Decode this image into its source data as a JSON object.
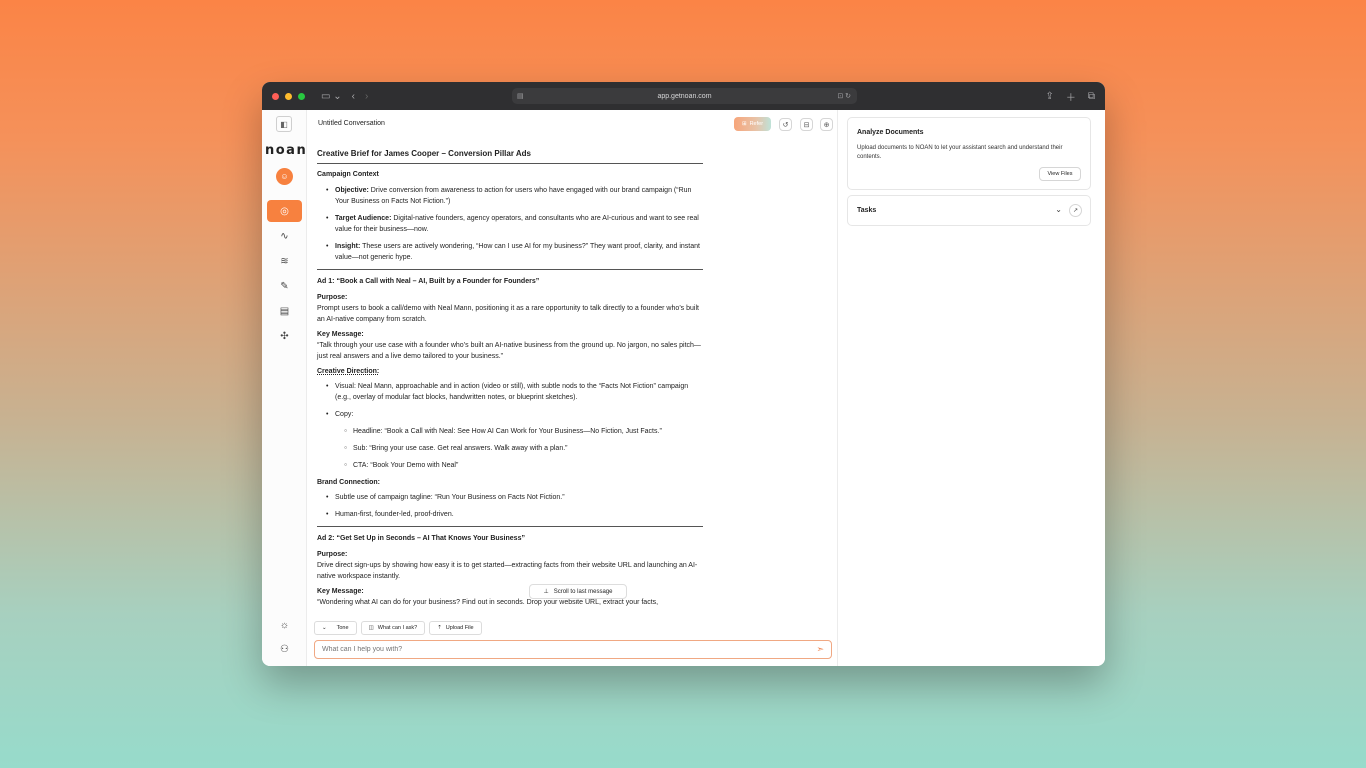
{
  "browser": {
    "url": "app.getnoan.com"
  },
  "sidebar": {
    "logo": "noan",
    "items": [
      {
        "name": "home",
        "active": true
      },
      {
        "name": "activity"
      },
      {
        "name": "layers"
      },
      {
        "name": "edit"
      },
      {
        "name": "notebook"
      },
      {
        "name": "network"
      }
    ]
  },
  "header": {
    "title": "Untitled Conversation",
    "refer_label": "Refer"
  },
  "brief": {
    "title": "Creative Brief for James Cooper – Conversion Pillar Ads",
    "campaign_context": "Campaign Context",
    "objective_label": "Objective:",
    "objective_text": " Drive conversion from awareness to action for users who have engaged with our brand campaign (“Run Your Business on Facts Not Fiction.”)",
    "audience_label": "Target Audience:",
    "audience_text": " Digital-native founders, agency operators, and consultants who are AI-curious and want to see real value for their business—now.",
    "insight_label": "Insight:",
    "insight_text": " These users are actively wondering, “How can I use AI for my business?” They want proof, clarity, and instant value—not generic hype.",
    "ad1_title": "Ad 1: “Book a Call with Neal – AI, Built by a Founder for Founders”",
    "purpose_label": "Purpose:",
    "ad1_purpose": "Prompt users to book a call/demo with Neal Mann, positioning it as a rare opportunity to talk directly to a founder who’s built an AI-native company from scratch.",
    "key_message_label": "Key Message:",
    "ad1_message": "“Talk through your use case with a founder who’s built an AI-native business from the ground up. No jargon, no sales pitch—just real answers and a live demo tailored to your business.”",
    "creative_direction_label": "Creative Direction:",
    "visual": "Visual: Neal Mann, approachable and in action (video or still), with subtle nods to the “Facts Not Fiction” campaign (e.g., overlay of modular fact blocks, handwritten notes, or blueprint sketches).",
    "copy_label": "Copy:",
    "headline": "Headline: “Book a Call with Neal: See How AI Can Work for Your Business—No Fiction, Just Facts.”",
    "sub": "Sub: “Bring your use case. Get real answers. Walk away with a plan.”",
    "cta": "CTA: “Book Your Demo with Neal”",
    "brand_connection_label": "Brand Connection:",
    "brand_1": "Subtle use of campaign tagline: “Run Your Business on Facts Not Fiction.”",
    "brand_2": "Human-first, founder-led, proof-driven.",
    "ad2_title": "Ad 2: “Get Set Up in Seconds – AI That Knows Your Business”",
    "ad2_purpose": "Drive direct sign-ups by showing how easy it is to get started—extracting facts from their website URL and launching an AI-native workspace instantly.",
    "ad2_message": "“Wondering what AI can do for your business? Find out in seconds. Drop your website URL, extract your facts,"
  },
  "scroll_pill": "Scroll to last message",
  "chips": {
    "tone": "Tone",
    "ask": "What can I ask?",
    "upload": "Upload File"
  },
  "chat": {
    "placeholder": "What can I help you with?"
  },
  "right": {
    "docs_title": "Analyze Documents",
    "docs_desc": "Upload documents to NOAN to let your assistant search and understand their contents.",
    "view_files": "View Files",
    "tasks_title": "Tasks"
  }
}
